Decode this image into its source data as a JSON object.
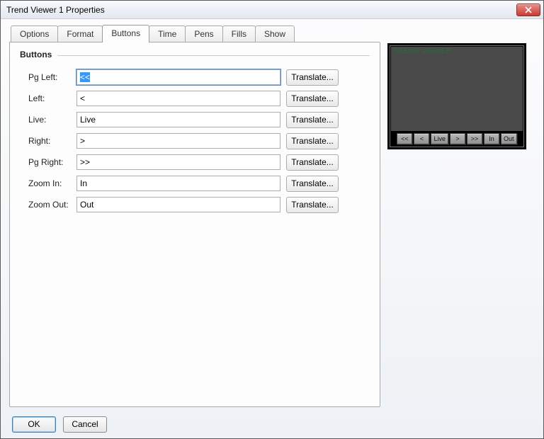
{
  "window": {
    "title": "Trend Viewer 1 Properties"
  },
  "tabs": {
    "options": "Options",
    "format": "Format",
    "buttons": "Buttons",
    "time": "Time",
    "pens": "Pens",
    "fills": "Fills",
    "show": "Show"
  },
  "group": {
    "label": "Buttons"
  },
  "fields": {
    "pg_left": {
      "label": "Pg Left:",
      "value": "<<"
    },
    "left": {
      "label": "Left:",
      "value": "<"
    },
    "live": {
      "label": "Live:",
      "value": "Live"
    },
    "right": {
      "label": "Right:",
      "value": ">"
    },
    "pg_right": {
      "label": "Pg Right:",
      "value": ">>"
    },
    "zoom_in": {
      "label": "Zoom In:",
      "value": "In"
    },
    "zoom_out": {
      "label": "Zoom Out:",
      "value": "Out"
    }
  },
  "translate_label": "Translate...",
  "footer": {
    "ok": "OK",
    "cancel": "Cancel"
  },
  "preview": {
    "title": "TREND VIEWER",
    "buttons": [
      "<<",
      "<",
      "Live",
      ">",
      ">>",
      "In",
      "Out"
    ]
  }
}
